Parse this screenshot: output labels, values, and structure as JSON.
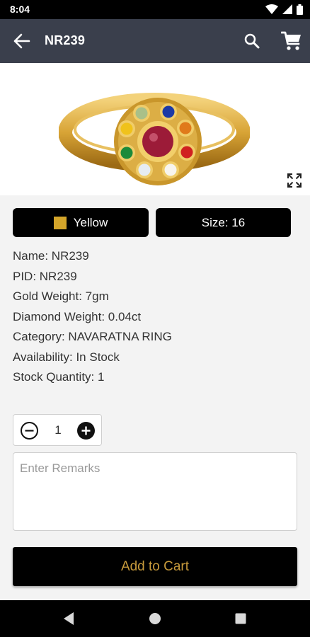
{
  "status_bar": {
    "time": "8:04"
  },
  "app_bar": {
    "title": "NR239"
  },
  "variants": {
    "color_label": "Yellow",
    "color_swatch": "#d4a52a",
    "size_label": "Size: 16"
  },
  "details": [
    "Name: NR239",
    "PID: NR239",
    "Gold Weight: 7gm",
    "Diamond Weight: 0.04ct",
    "Category: NAVARATNA RING",
    "Availability: In Stock",
    "Stock Quantity: 1"
  ],
  "quantity": {
    "value": "1"
  },
  "remarks": {
    "placeholder": "Enter Remarks",
    "value": ""
  },
  "add_to_cart_label": "Add to Cart",
  "colors": {
    "app_bar": "#3a3f4c",
    "button_bg": "#000000",
    "cart_text": "#c89b3c"
  },
  "icons": {
    "back": "arrow-left-icon",
    "search": "search-icon",
    "cart": "shopping-cart-icon",
    "expand": "fullscreen-icon",
    "minus": "minus-circle-icon",
    "plus": "plus-circle-icon"
  }
}
